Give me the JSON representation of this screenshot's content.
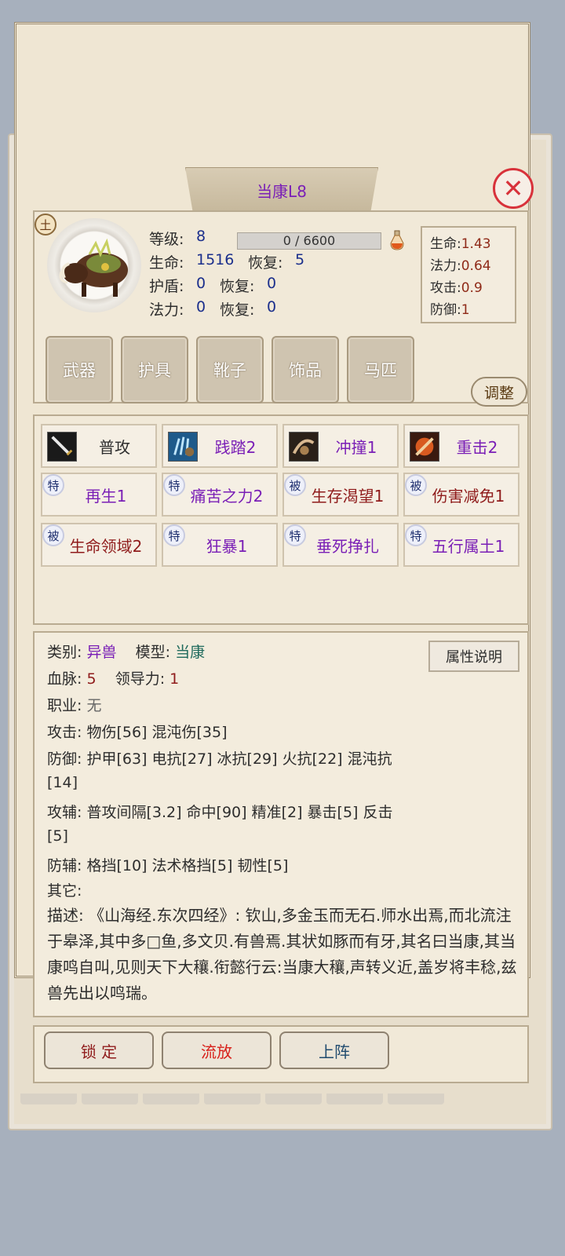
{
  "title": "当康L8",
  "element_badge": "土",
  "stats": {
    "level_label": "等级:",
    "level": "8",
    "exp": "0 / 6600",
    "hp_label": "生命:",
    "hp": "1516",
    "hp_regen_label": "恢复:",
    "hp_regen": "5",
    "shield_label": "护盾:",
    "shield": "0",
    "shield_regen_label": "恢复:",
    "shield_regen": "0",
    "mp_label": "法力:",
    "mp": "0",
    "mp_regen_label": "恢复:",
    "mp_regen": "0"
  },
  "growth": [
    {
      "label": "生命:",
      "value": "1.43"
    },
    {
      "label": "法力:",
      "value": "0.64"
    },
    {
      "label": "攻击:",
      "value": "0.9"
    },
    {
      "label": "防御:",
      "value": "1"
    }
  ],
  "equipment": [
    "武器",
    "护具",
    "靴子",
    "饰品",
    "马匹"
  ],
  "adjust_label": "调整",
  "skills": [
    {
      "label": "普攻",
      "tag": "",
      "color": "#2d2d2d"
    },
    {
      "label": "践踏2",
      "tag": "",
      "color": "#7a1fb6"
    },
    {
      "label": "冲撞1",
      "tag": "",
      "color": "#7a1fb6"
    },
    {
      "label": "重击2",
      "tag": "",
      "color": "#7a1fb6"
    },
    {
      "label": "再生1",
      "tag": "特",
      "color": "#7a1fb6"
    },
    {
      "label": "痛苦之力2",
      "tag": "特",
      "color": "#7a1fb6"
    },
    {
      "label": "生存渴望1",
      "tag": "被",
      "color": "#8f1b1b"
    },
    {
      "label": "伤害减免1",
      "tag": "被",
      "color": "#8f1b1b"
    },
    {
      "label": "生命领域2",
      "tag": "被",
      "color": "#8f1b1b"
    },
    {
      "label": "狂暴1",
      "tag": "特",
      "color": "#7a1fb6"
    },
    {
      "label": "垂死挣扎",
      "tag": "特",
      "color": "#7a1fb6"
    },
    {
      "label": "五行属土1",
      "tag": "特",
      "color": "#7a1fb6"
    }
  ],
  "info": {
    "category_label": "类别:",
    "category": "异兽",
    "model_label": "模型:",
    "model": "当康",
    "bloodline_label": "血脉:",
    "bloodline": "5",
    "leadership_label": "领导力:",
    "leadership": "1",
    "job_label": "职业:",
    "job": "无",
    "attack_label": "攻击:",
    "attack": "物伤[56] 混沌伤[35]",
    "defense_label": "防御:",
    "defense_1": "护甲[63] 电抗[27] 冰抗[29] 火抗[22] 混沌抗",
    "defense_2": "[14]",
    "atk_aux_label": "攻辅:",
    "atk_aux_1": "普攻间隔[3.2] 命中[90] 精准[2] 暴击[5] 反击",
    "atk_aux_2": "[5]",
    "def_aux_label": "防辅:",
    "def_aux": "格挡[10] 法术格挡[5] 韧性[5]",
    "other_label": "其它:",
    "desc_label": "描述:",
    "desc": "《山海经.东次四经》: 钦山,多金玉而无石.师水出焉,而北流注于皋泽,其中多□鱼,多文贝.有兽焉.其状如豚而有牙,其名曰当康,其当 康鸣自叫,见则天下大穰.衔懿行云:当康大穰,声转义近,盖岁将丰稔,兹兽先出以鸣瑞。"
  },
  "attr_button": "属性说明",
  "actions": {
    "lock": "锁 定",
    "release": "流放",
    "deploy": "上阵"
  }
}
